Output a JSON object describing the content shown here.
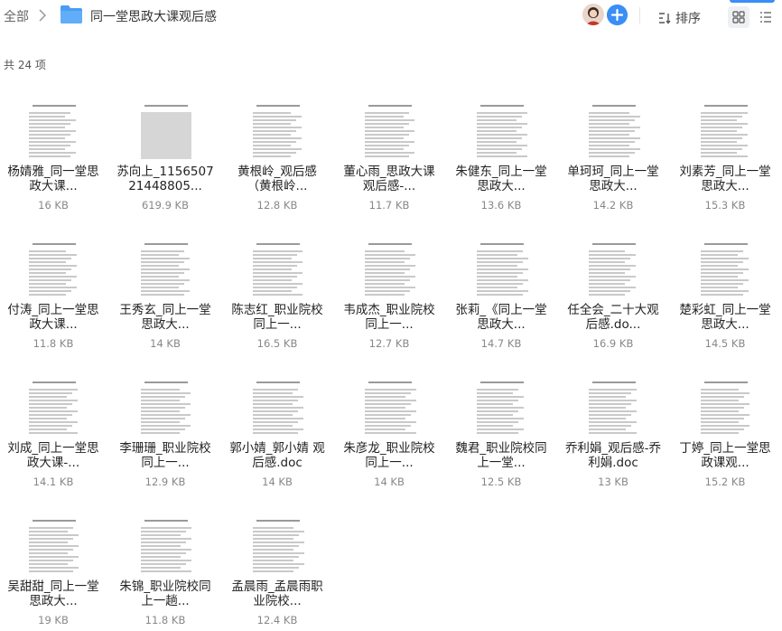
{
  "breadcrumb": {
    "root": "全部",
    "current": "同一堂思政大课观后感"
  },
  "toolbar": {
    "sort_label": "排序"
  },
  "summary": {
    "count_text": "共 24 项"
  },
  "colors": {
    "accent": "#3a8ef6",
    "folder": "#4a9cf5"
  },
  "icons": {
    "separator": "chevron-right-icon",
    "folder": "folder-icon",
    "add": "plus-circle-icon",
    "sort": "sort-icon",
    "grid": "grid-view-icon",
    "list": "list-view-icon"
  },
  "files": [
    {
      "name": "杨婧雅_同一堂思政大课...",
      "size": "16 KB"
    },
    {
      "name": "苏向上_115650721448805...",
      "size": "619.9 KB"
    },
    {
      "name": "黄根岭_观后感（黄根岭...",
      "size": "12.8 KB"
    },
    {
      "name": "董心雨_思政大课观后感-...",
      "size": "11.7 KB"
    },
    {
      "name": "朱健东_同上一堂思政大...",
      "size": "13.6 KB"
    },
    {
      "name": "单珂珂_同上一堂思政大...",
      "size": "14.2 KB"
    },
    {
      "name": "刘素芳_同上一堂思政大...",
      "size": "15.3 KB"
    },
    {
      "name": "付涛_同上一堂思政大课...",
      "size": "11.8 KB"
    },
    {
      "name": "王秀玄_同上一堂思政大...",
      "size": "14 KB"
    },
    {
      "name": "陈志红_职业院校同上一...",
      "size": "16.5 KB"
    },
    {
      "name": "韦成杰_职业院校同上一...",
      "size": "12.7 KB"
    },
    {
      "name": "张莉_《同上一堂思政大...",
      "size": "14.7 KB"
    },
    {
      "name": "任全会_二十大观后感.do...",
      "size": "16.9 KB"
    },
    {
      "name": "楚彩虹_同上一堂思政大...",
      "size": "14.5 KB"
    },
    {
      "name": "刘成_同上一堂思政大课-...",
      "size": "14.1 KB"
    },
    {
      "name": "李珊珊_职业院校同上一...",
      "size": "12.9 KB"
    },
    {
      "name": "郭小婧_郭小婧 观后感.doc",
      "size": "14 KB"
    },
    {
      "name": "朱彦龙_职业院校同上一...",
      "size": "14 KB"
    },
    {
      "name": "魏君_职业院校同上一堂...",
      "size": "12.5 KB"
    },
    {
      "name": "乔利娟_观后感-乔利娟.doc",
      "size": "13 KB"
    },
    {
      "name": "丁婷_同上一堂思政课观...",
      "size": "15.2 KB"
    },
    {
      "name": "吴甜甜_同上一堂思政大...",
      "size": "19 KB"
    },
    {
      "name": "朱锦_职业院校同上一趟...",
      "size": "11.8 KB"
    },
    {
      "name": "孟晨雨_孟晨雨职业院校...",
      "size": "12.4 KB"
    }
  ]
}
